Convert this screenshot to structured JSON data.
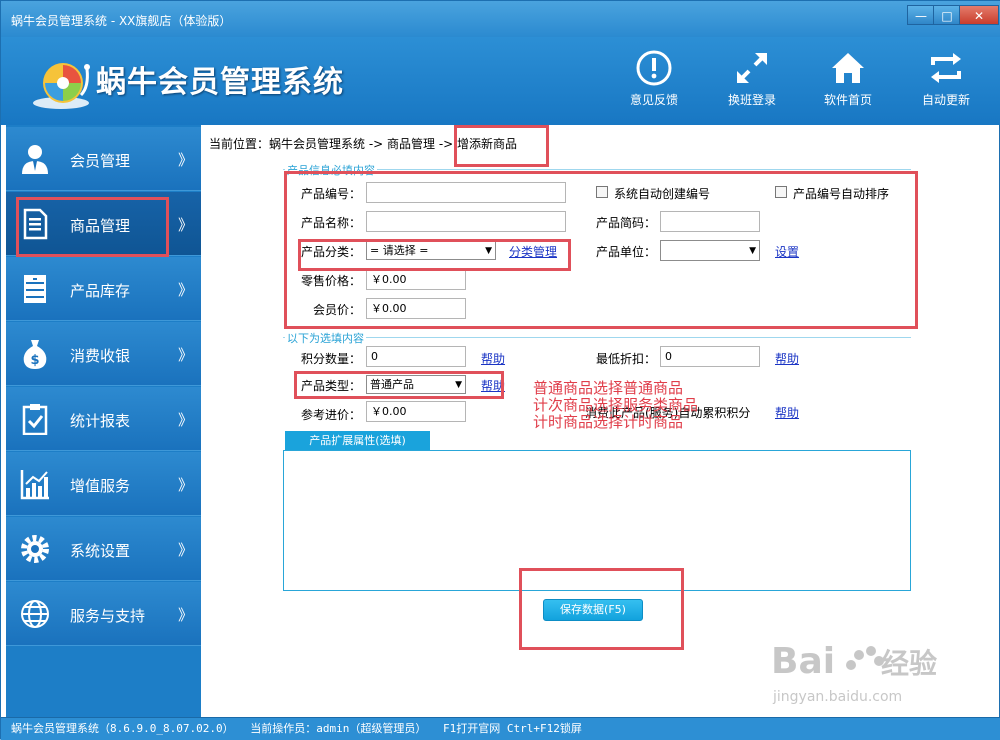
{
  "window": {
    "title": "蜗牛会员管理系统 - XX旗舰店（体验版）",
    "controls": [
      "—",
      "□",
      "✕"
    ]
  },
  "header": {
    "app_name": "蜗牛会员管理系统",
    "buttons": [
      {
        "label": "意见反馈",
        "icon": "alert-circle-icon"
      },
      {
        "label": "换班登录",
        "icon": "expand-arrows-icon"
      },
      {
        "label": "软件首页",
        "icon": "home-icon"
      },
      {
        "label": "自动更新",
        "icon": "refresh-arrows-icon"
      }
    ]
  },
  "sidebar": {
    "items": [
      {
        "label": "会员管理",
        "icon": "member-user-icon",
        "chev": "》"
      },
      {
        "label": "商品管理",
        "icon": "document-icon",
        "chev": "》",
        "active": true
      },
      {
        "label": "产品库存",
        "icon": "cabinet-icon",
        "chev": "》"
      },
      {
        "label": "消费收银",
        "icon": "money-bag-icon",
        "chev": "》"
      },
      {
        "label": "统计报表",
        "icon": "clipboard-check-icon",
        "chev": "》"
      },
      {
        "label": "增值服务",
        "icon": "bar-chart-icon",
        "chev": "》"
      },
      {
        "label": "系统设置",
        "icon": "gear-icon",
        "chev": "》"
      },
      {
        "label": "服务与支持",
        "icon": "globe-icon",
        "chev": "》"
      }
    ]
  },
  "breadcrumb": {
    "prefix": "当前位置：蜗牛会员管理系统 -> 商品管理 ->",
    "current": "增添新商品"
  },
  "form": {
    "required_section_title": "产品信息必填内容",
    "optional_section_title": "以下为选填内容",
    "product_code_label": "产品编号：",
    "product_code_value": "",
    "auto_code_label": "系统自动创建编号",
    "auto_sort_label": "产品编号自动排序",
    "product_name_label": "产品名称：",
    "product_name_value": "",
    "short_code_label": "产品简码：",
    "short_code_value": "",
    "category_label": "产品分类：",
    "category_value": "= 请选择 =",
    "category_manage_link": "分类管理",
    "unit_label": "产品单位：",
    "unit_value": "",
    "unit_setting_link": "设置",
    "retail_price_label": "零售价格：",
    "retail_price_value": "￥0.00",
    "member_price_label": "会员价：",
    "member_price_value": "￥0.00",
    "points_label": "积分数量：",
    "points_value": "0",
    "points_help": "帮助",
    "min_discount_label": "最低折扣：",
    "min_discount_value": "0",
    "min_discount_help": "帮助",
    "product_type_label": "产品类型：",
    "product_type_value": "普通产品",
    "product_type_help": "帮助",
    "ref_price_label": "参考进价：",
    "ref_price_value": "￥0.00",
    "consume_points_note": "消费此产品(服务)自动累积积分",
    "consume_points_help": "帮助",
    "ext_tab_label": "产品扩展属性(选填)",
    "save_button": "保存数据(F5)"
  },
  "annotations": {
    "line1": "普通商品选择普通商品",
    "line2": "计次商品选择服务类商品",
    "line3": "计时商品选择计时商品",
    "color": "#e03e4a"
  },
  "statusbar": {
    "version": "蜗牛会员管理系统（8.6.9.0_8.07.02.0）",
    "operator": "当前操作员：admin（超级管理员）",
    "hotkeys": "F1打开官网 Ctrl+F12锁屏"
  },
  "watermark": {
    "brand": "Bai du 经验",
    "url": "jingyan.baidu.com"
  },
  "colors": {
    "header_blue": "#1877c3",
    "sidebar_blue": "#1d7ec7",
    "accent_cyan": "#2aa3d6",
    "highlight_red": "#e0505a",
    "link_blue": "#1b35c5"
  }
}
